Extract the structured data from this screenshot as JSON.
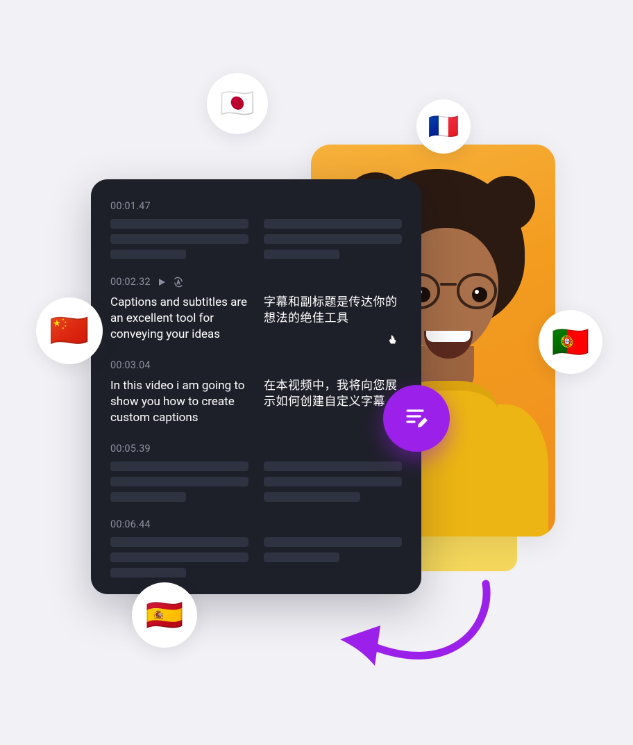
{
  "colors": {
    "accent": "#9b20ea",
    "panel": "#1e2029",
    "muted": "#8b8f9d"
  },
  "flags": {
    "jp": "🇯🇵",
    "fr": "🇫🇷",
    "cn": "🇨🇳",
    "pt": "🇵🇹",
    "es": "🇪🇸"
  },
  "captions": [
    {
      "time": "00:01.47",
      "en": "",
      "zh": "",
      "placeholder": true
    },
    {
      "time": "00:02.32",
      "en": "Captions and subtitles are an excellent tool for conveying your ideas",
      "zh": "字幕和副标题是传达你的想法的绝佳工具",
      "active": true
    },
    {
      "time": "00:03.04",
      "en": "In this video i am going to show you how to create custom captions",
      "zh": "在本视频中，我将向您展示如何创建自定义字幕"
    },
    {
      "time": "00:05.39",
      "en": "",
      "zh": "",
      "placeholder": true
    },
    {
      "time": "00:06.44",
      "en": "",
      "zh": "",
      "placeholder": true
    }
  ],
  "icons": {
    "play": "play-icon",
    "autoA": "auto-a-icon",
    "edit": "edit-captions-icon",
    "pointer": "pointer-cursor-icon"
  }
}
